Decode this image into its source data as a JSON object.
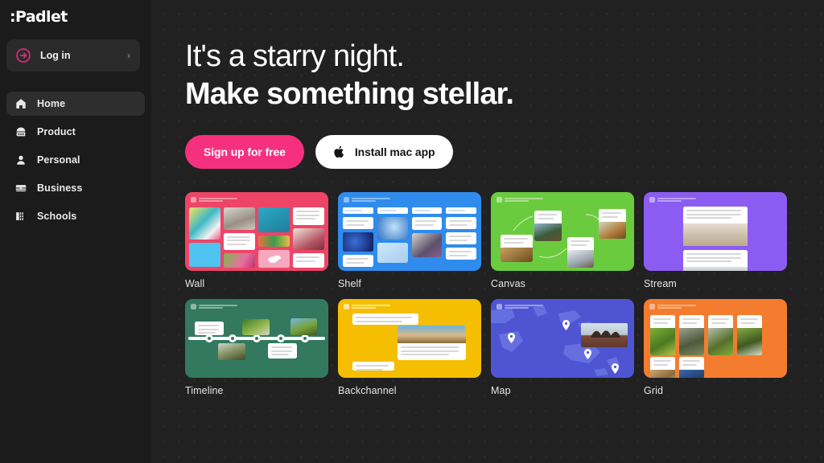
{
  "sidebar": {
    "brand": ":Padlet",
    "login": {
      "label": "Log in",
      "icon": "arrow-in-circle-icon",
      "chevron": "›",
      "accent": "#e0267d"
    },
    "items": [
      {
        "label": "Home",
        "icon": "home-icon",
        "active": true
      },
      {
        "label": "Product",
        "icon": "product-icon",
        "active": false
      },
      {
        "label": "Personal",
        "icon": "person-icon",
        "active": false
      },
      {
        "label": "Business",
        "icon": "briefcase-icon",
        "active": false
      },
      {
        "label": "Schools",
        "icon": "school-icon",
        "active": false
      }
    ]
  },
  "hero": {
    "line1": "It's a starry night.",
    "line2": "Make something stellar.",
    "cta_primary": {
      "label": "Sign up for free",
      "color": "#f5317f"
    },
    "cta_secondary": {
      "label": "Install mac app",
      "icon": "apple-icon",
      "color": "#ffffff"
    }
  },
  "templates": [
    {
      "label": "Wall",
      "color": "#ee4466"
    },
    {
      "label": "Shelf",
      "color": "#2f8ced"
    },
    {
      "label": "Canvas",
      "color": "#6bcb3e"
    },
    {
      "label": "Stream",
      "color": "#8c5cf2"
    },
    {
      "label": "Timeline",
      "color": "#33795f"
    },
    {
      "label": "Backchannel",
      "color": "#f5be00"
    },
    {
      "label": "Map",
      "color": "#4f55d2"
    },
    {
      "label": "Grid",
      "color": "#f47c2f"
    }
  ],
  "theme": {
    "background": "#212121",
    "sidebar": "#1b1b1b",
    "text": "#ffffff"
  }
}
